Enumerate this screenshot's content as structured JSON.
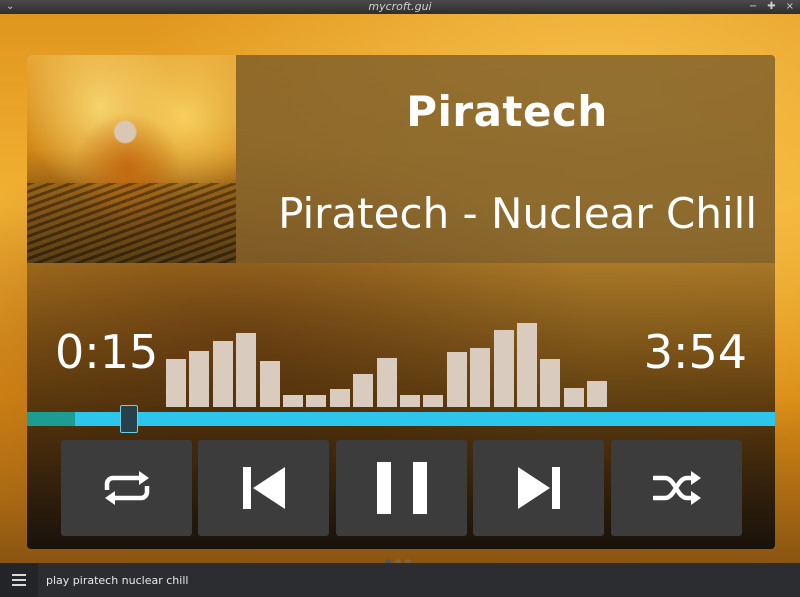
{
  "window": {
    "title": "mycroft.gui"
  },
  "now_playing": {
    "artist": "Piratech",
    "track": "Piratech - Nuclear Chill",
    "elapsed": "0:15",
    "duration": "3:54",
    "progress_fraction": 0.064
  },
  "spectrum": [
    0.55,
    0.64,
    0.75,
    0.84,
    0.52,
    0.14,
    0.14,
    0.2,
    0.38,
    0.56,
    0.14,
    0.14,
    0.62,
    0.67,
    0.87,
    0.95,
    0.54,
    0.22,
    0.3
  ],
  "controls": {
    "repeat": "repeat-icon",
    "previous": "skip-previous-icon",
    "pause": "pause-icon",
    "next": "skip-next-icon",
    "shuffle": "shuffle-icon"
  },
  "pages": {
    "count": 3,
    "active": 0
  },
  "bottom_bar": {
    "utterance": "play piratech nuclear chill"
  },
  "colors": {
    "progress": "#2cc6ec",
    "progress_fill": "#1d9c94",
    "button_bg": "#3c3c3c"
  }
}
